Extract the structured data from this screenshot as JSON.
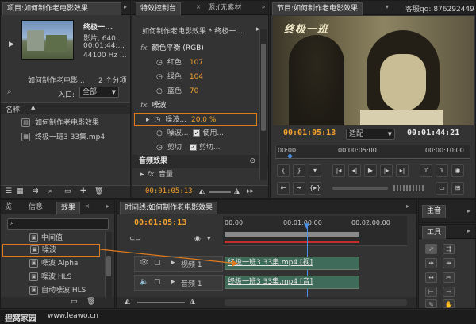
{
  "project_panel": {
    "tab_project": "项目:如何制作老电影效果",
    "clip_title": "终极一...",
    "clip_type": "影片, 640...",
    "clip_duration": "00;01;44;...",
    "clip_audio": "44100 Hz ...",
    "project_name": "如何制作老电影...",
    "item_count": "2 个分项",
    "entry_label": "入口:",
    "entry_value": "全部",
    "name_header": "名称",
    "items": [
      {
        "label": "如何制作老电影效果"
      },
      {
        "label": "终极一班3 33集.mp4"
      }
    ]
  },
  "effect_controls": {
    "tab_effect_controls": "特效控制台",
    "tab_source": "源:(无素材",
    "sequence_title": "如何制作老电影效果 * 终极一...",
    "color_balance": "颜色平衡 (RGB)",
    "red_label": "红色",
    "red_value": "107",
    "green_label": "绿色",
    "green_value": "104",
    "blue_label": "蓝色",
    "blue_value": "70",
    "noise_section": "噪波",
    "noise_param_label": "噪波...",
    "noise_param_value": "20.0 %",
    "noise_type_label": "噪波...",
    "noise_type_check": "使用...",
    "clip_label": "剪切",
    "clip_check": "剪切...",
    "audio_effects": "音频效果",
    "volume_label": "音量",
    "timecode": "00:01:05:13"
  },
  "program_monitor": {
    "tab_program": "节目:如何制作老电影效果",
    "qq_text": "客服qq: 876292449",
    "video_caption": "终极一班",
    "timecode_current": "00:01:05:13",
    "fit_label": "适配",
    "timecode_total": "00:01:44:21",
    "ruler_start": "00:00",
    "ruler_mid1": "00:00:05:00",
    "ruler_mid2": "00:00:10:00"
  },
  "effects_panel": {
    "tab_preview": "览",
    "tab_info": "信息",
    "tab_effects": "效果",
    "items": [
      {
        "label": "中间值"
      },
      {
        "label": "噪波"
      },
      {
        "label": "噪波 Alpha"
      },
      {
        "label": "噪波 HLS"
      },
      {
        "label": "自动噪波 HLS"
      }
    ]
  },
  "timeline": {
    "tab": "时间线:如何制作老电影效果",
    "timecode": "00:01:05:13",
    "ruler_start": "00:00",
    "ruler_mid": "00:01:00:00",
    "ruler_end": "00:02:00:00",
    "video_track": "视频 1",
    "audio_track": "音频 1",
    "video_clip": "终极一班3 33集.mp4 [视]",
    "audio_clip": "终极一班3 33集.mp4 [音]"
  },
  "tools_panel": {
    "tab_audio_master": "主音",
    "tab_tools": "工具"
  },
  "watermark": {
    "site_name": "狸窝家园",
    "url": "www.leawo.cn"
  },
  "colors": {
    "accent": "#f2a12b",
    "highlight_box": "#e07a1f",
    "playhead": "#4a8ee6",
    "clip_green": "#3f6b5a"
  }
}
